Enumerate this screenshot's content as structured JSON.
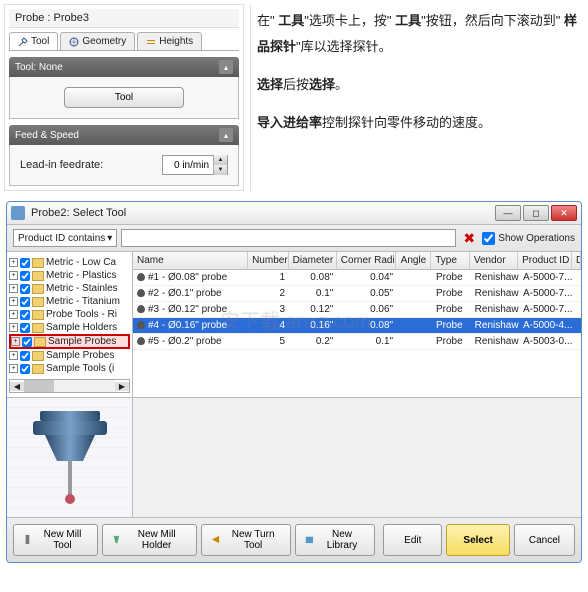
{
  "probe_panel": {
    "title": "Probe : Probe3",
    "tabs": {
      "tool": "Tool",
      "geometry": "Geometry",
      "heights": "Heights"
    },
    "tool_section": {
      "header": "Tool: None",
      "button": "Tool"
    },
    "feed_section": {
      "header": "Feed & Speed",
      "label": "Lead-in feedrate:",
      "value": "0 in/min"
    }
  },
  "instructions": {
    "p1a": "在\" ",
    "p1b": "工具",
    "p1c": "\"选项卡上，按\" ",
    "p1d": "工具",
    "p1e": "\"按钮，然后向下滚动到\" ",
    "p1f": "样品探针",
    "p1g": "\"库以选择探针。",
    "p2a": "选择",
    "p2b": "后按",
    "p2c": "选择",
    "p2d": "。",
    "p3a": "导入进给率",
    "p3b": "控制探针向零件移动的速度。"
  },
  "dialog": {
    "title": "Probe2: Select Tool",
    "filter": {
      "selected": "Product ID contains",
      "show_ops": "Show Operations"
    },
    "tree": [
      "Metric - Low Ca",
      "Metric - Plastics",
      "Metric - Stainles",
      "Metric - Titanium",
      "Probe Tools - Ri",
      "Sample Holders",
      "Sample Probes",
      "Sample Probes",
      "Sample Tools (i"
    ],
    "columns": [
      "Name",
      "Number",
      "Diameter",
      "Corner Radius",
      "Angle",
      "Type",
      "Vendor",
      "Product ID",
      "Descrip"
    ],
    "rows": [
      {
        "name": "#1 - Ø0.08\" probe",
        "num": "1",
        "dia": "0.08\"",
        "cr": "0.04\"",
        "ang": "",
        "type": "Probe",
        "vendor": "Renishaw",
        "pid": "A-5000-7..."
      },
      {
        "name": "#2 - Ø0.1\" probe",
        "num": "2",
        "dia": "0.1\"",
        "cr": "0.05\"",
        "ang": "",
        "type": "Probe",
        "vendor": "Renishaw",
        "pid": "A-5000-7..."
      },
      {
        "name": "#3 - Ø0.12\" probe",
        "num": "3",
        "dia": "0.12\"",
        "cr": "0.06\"",
        "ang": "",
        "type": "Probe",
        "vendor": "Renishaw",
        "pid": "A-5000-7..."
      },
      {
        "name": "#4 - Ø0.16\" probe",
        "num": "4",
        "dia": "0.16\"",
        "cr": "0.08\"",
        "ang": "",
        "type": "Probe",
        "vendor": "Renishaw",
        "pid": "A-5000-4..."
      },
      {
        "name": "#5 - Ø0.2\" probe",
        "num": "5",
        "dia": "0.2\"",
        "cr": "0.1\"",
        "ang": "",
        "type": "Probe",
        "vendor": "Renishaw",
        "pid": "A-5003-0..."
      }
    ],
    "selected_row": 3,
    "buttons": {
      "new_mill_tool": "New Mill Tool",
      "new_mill_holder": "New Mill Holder",
      "new_turn_tool": "New Turn Tool",
      "new_library": "New Library",
      "edit": "Edit",
      "select": "Select",
      "cancel": "Cancel"
    }
  },
  "watermark": "安下载 anxz.com"
}
